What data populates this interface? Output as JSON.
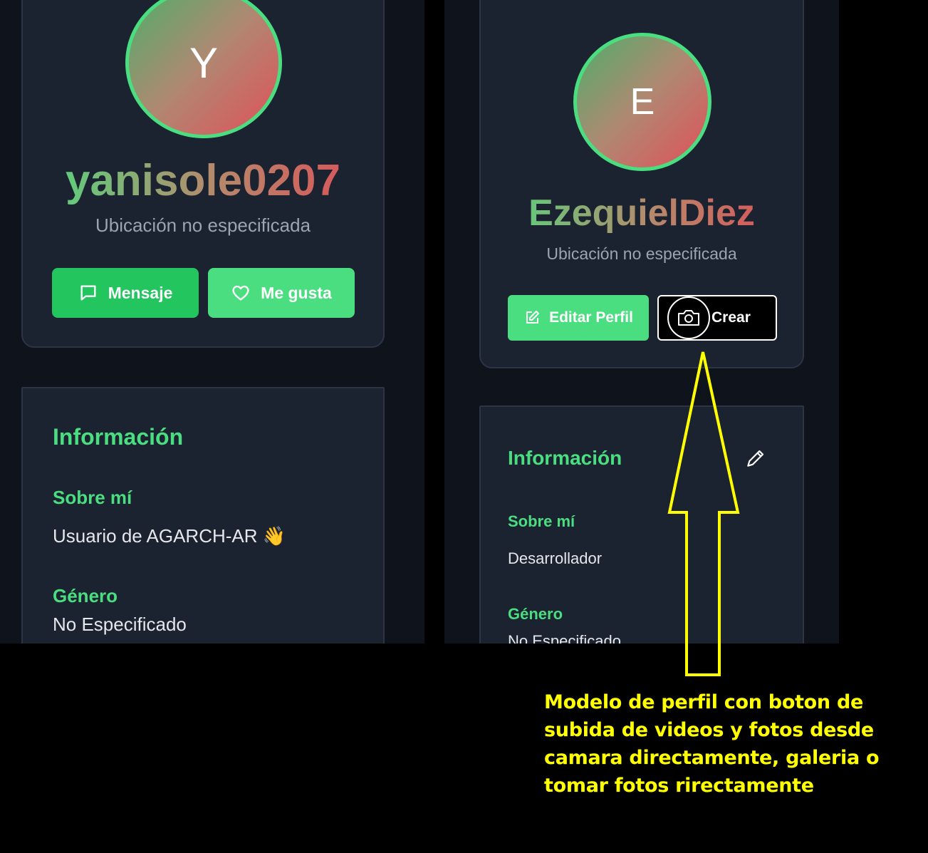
{
  "left_profile": {
    "avatar_initial": "Y",
    "username": "yanisole0207",
    "location": "Ubicación no especificada",
    "buttons": {
      "message_label": "Mensaje",
      "like_label": "Me gusta",
      "message_icon": "chat-bubble-icon",
      "like_icon": "heart-icon"
    },
    "info": {
      "title": "Información",
      "about_label": "Sobre mí",
      "about_value": "Usuario de AGARCH-AR 👋",
      "gender_label": "Género",
      "gender_value": "No Especificado"
    }
  },
  "right_profile": {
    "avatar_initial": "E",
    "username": "EzequielDiez",
    "location": "Ubicación no especificada",
    "buttons": {
      "edit_label": "Editar Perfil",
      "create_label": "Crear",
      "edit_icon": "edit-square-icon",
      "create_icon": "camera-icon"
    },
    "info": {
      "title": "Información",
      "edit_icon": "pencil-icon",
      "about_label": "Sobre mí",
      "about_value": "Desarrollador",
      "gender_label": "Género",
      "gender_value": "No Especificado"
    }
  },
  "annotation": {
    "lines": [
      "Modelo de perfil con boton de",
      "subida de videos y fotos desde",
      "camara directamente, galeria o",
      "tomar fotos rirectamente"
    ],
    "color": "#ffff00"
  },
  "colors": {
    "accent_green": "#4ade80",
    "button_dark_green": "#22c55e",
    "card_bg": "#1b2230",
    "page_bg": "#0f141c",
    "gradient_end_red": "#e1505a"
  }
}
